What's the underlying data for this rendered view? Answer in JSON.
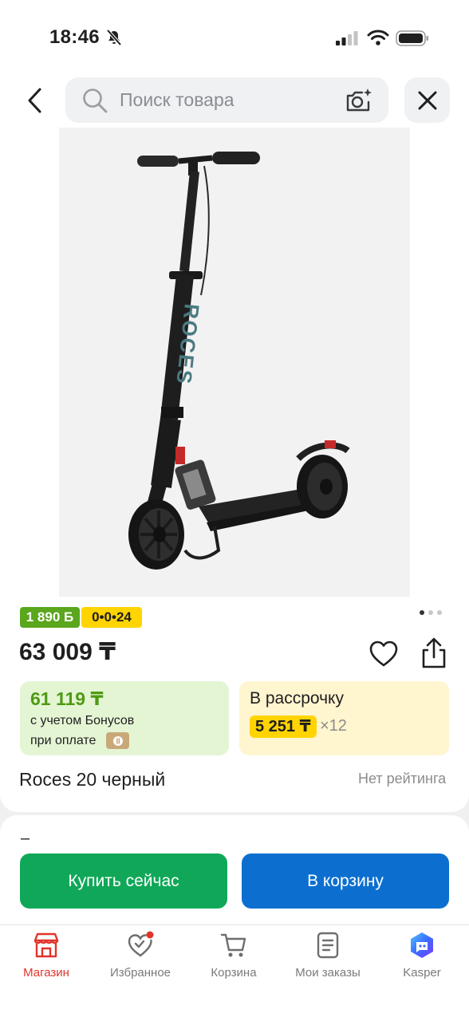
{
  "status_bar": {
    "time": "18:46"
  },
  "search": {
    "placeholder": "Поиск товара"
  },
  "badges": {
    "bonus": "1 890 Б",
    "installment": "0•0•24"
  },
  "product": {
    "price": "63 009 ₸",
    "title": "Roces 20 черный",
    "rating": "Нет рейтинга",
    "image_pages": {
      "count": 3,
      "active": 0
    }
  },
  "bonus_offer": {
    "price": "61 119 ₸",
    "line1": "с учетом Бонусов",
    "line2": "при оплате"
  },
  "installment_offer": {
    "title": "В рассрочку",
    "amount": "5 251 ₸",
    "months": "×12"
  },
  "section": {
    "dash": "–"
  },
  "actions": {
    "buy_now": "Купить сейчас",
    "add_to_cart": "В корзину"
  },
  "tabs": [
    {
      "label": "Магазин",
      "icon": "shop-icon",
      "active": true
    },
    {
      "label": "Избранное",
      "icon": "heart-icon",
      "notification_dot": true
    },
    {
      "label": "Корзина",
      "icon": "cart-icon"
    },
    {
      "label": "Мои заказы",
      "icon": "orders-icon"
    },
    {
      "label": "Kasper",
      "icon": "kasper-icon"
    }
  ],
  "colors": {
    "accent_red": "#e1342b",
    "green_button": "#10a858",
    "blue_button": "#0c6fd0",
    "bonus_green": "#5aa61d",
    "installment_yellow": "#ffd400"
  }
}
